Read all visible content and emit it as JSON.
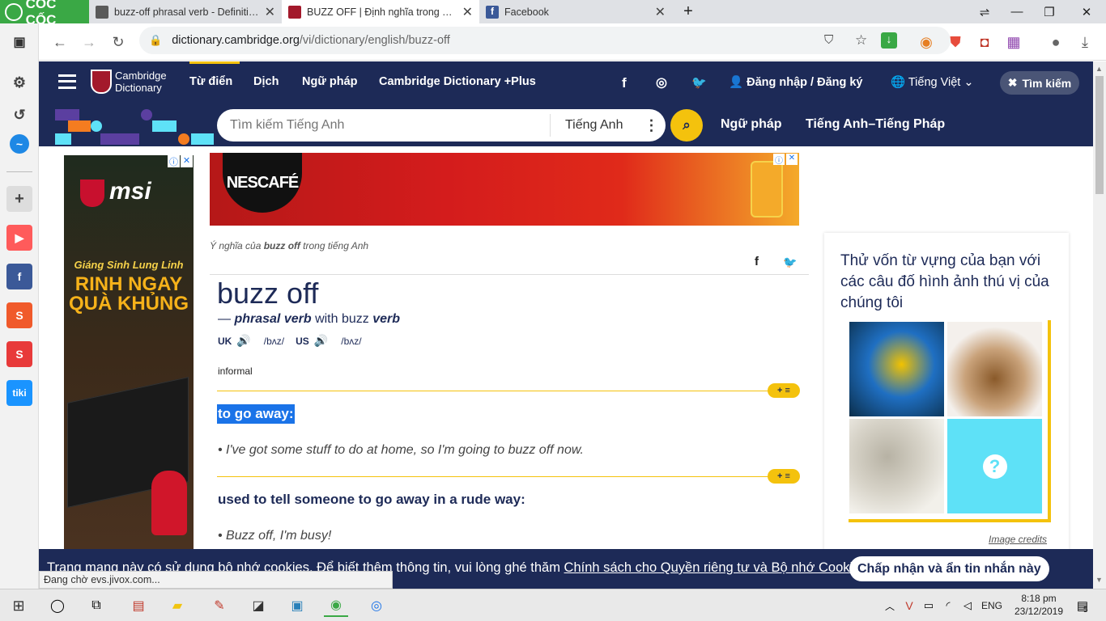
{
  "browser": {
    "brand": "CỐC CỐC",
    "tabs": [
      {
        "title": "buzz-off phrasal verb - Definition, pictures,",
        "active": false
      },
      {
        "title": "BUZZ OFF | Định nghĩa trong Từ điển",
        "active": true
      },
      {
        "title": "Facebook",
        "active": false
      }
    ],
    "new_tab": "+",
    "url_host": "dictionary.cambridge.org",
    "url_path": "/vi/dictionary/english/buzz-off"
  },
  "site": {
    "logo_line1": "Cambridge",
    "logo_line2": "Dictionary",
    "nav": [
      "Từ điển",
      "Dịch",
      "Ngữ pháp",
      "Cambridge Dictionary +Plus"
    ],
    "login": "Đăng nhập / Đăng ký",
    "language": "Tiếng Việt",
    "search_button": "Tìm kiếm",
    "search_placeholder": "Tìm kiếm Tiếng Anh",
    "search_lang": "Tiếng Anh",
    "sub_links": [
      "Ngữ pháp",
      "Tiếng Anh–Tiếng Pháp"
    ]
  },
  "ads": {
    "left_brand": "msi",
    "left_line1": "Giáng Sinh Lung Linh",
    "left_line2": "RINH NGAY",
    "left_line3": "QUÀ KHỦNG",
    "top_brand": "NESCAFÉ"
  },
  "entry": {
    "breadcrumb_pre": "Ý nghĩa của ",
    "breadcrumb_word": "buzz off",
    "breadcrumb_post": " trong tiếng Anh",
    "headword": "buzz off",
    "pos_prefix": "—",
    "pos": "phrasal verb",
    "pos_with": "with buzz",
    "pos_verb": "verb",
    "uk_label": "UK",
    "uk_ipa": "/bʌz/",
    "us_label": "US",
    "us_ipa": "/bʌz/",
    "register": "informal",
    "senses": [
      {
        "definition": "to go away:",
        "example": "I've got some stuff to do at home, so I'm going to buzz off now."
      },
      {
        "definition": "used to tell someone to go away in a rude way:",
        "example": "Buzz off, I'm busy!"
      }
    ],
    "pill_label": "+ ≡"
  },
  "quiz": {
    "title": "Thử vốn từ vựng của bạn với các câu đố hình ảnh thú vị của chúng tôi",
    "credits": "Image credits"
  },
  "cookie": {
    "text": "Trang mạng này có sử dụng bộ nhớ cookies. Để biết thêm thông tin, vui lòng ghé thăm ",
    "link": "Chính sách cho Quyền riêng tư và Bộ nhớ Cookies",
    "period": ".",
    "button": "Chấp nhận và ẩn tin nhắn này"
  },
  "status_text": "Đang chờ evs.jivox.com...",
  "taskbar": {
    "lang": "ENG",
    "time": "8:18 pm",
    "date": "23/12/2019",
    "notifications": "5"
  },
  "colors": {
    "navy": "#1d2a57",
    "accent": "#f4c20d",
    "coccoc_green": "#3aa845"
  }
}
